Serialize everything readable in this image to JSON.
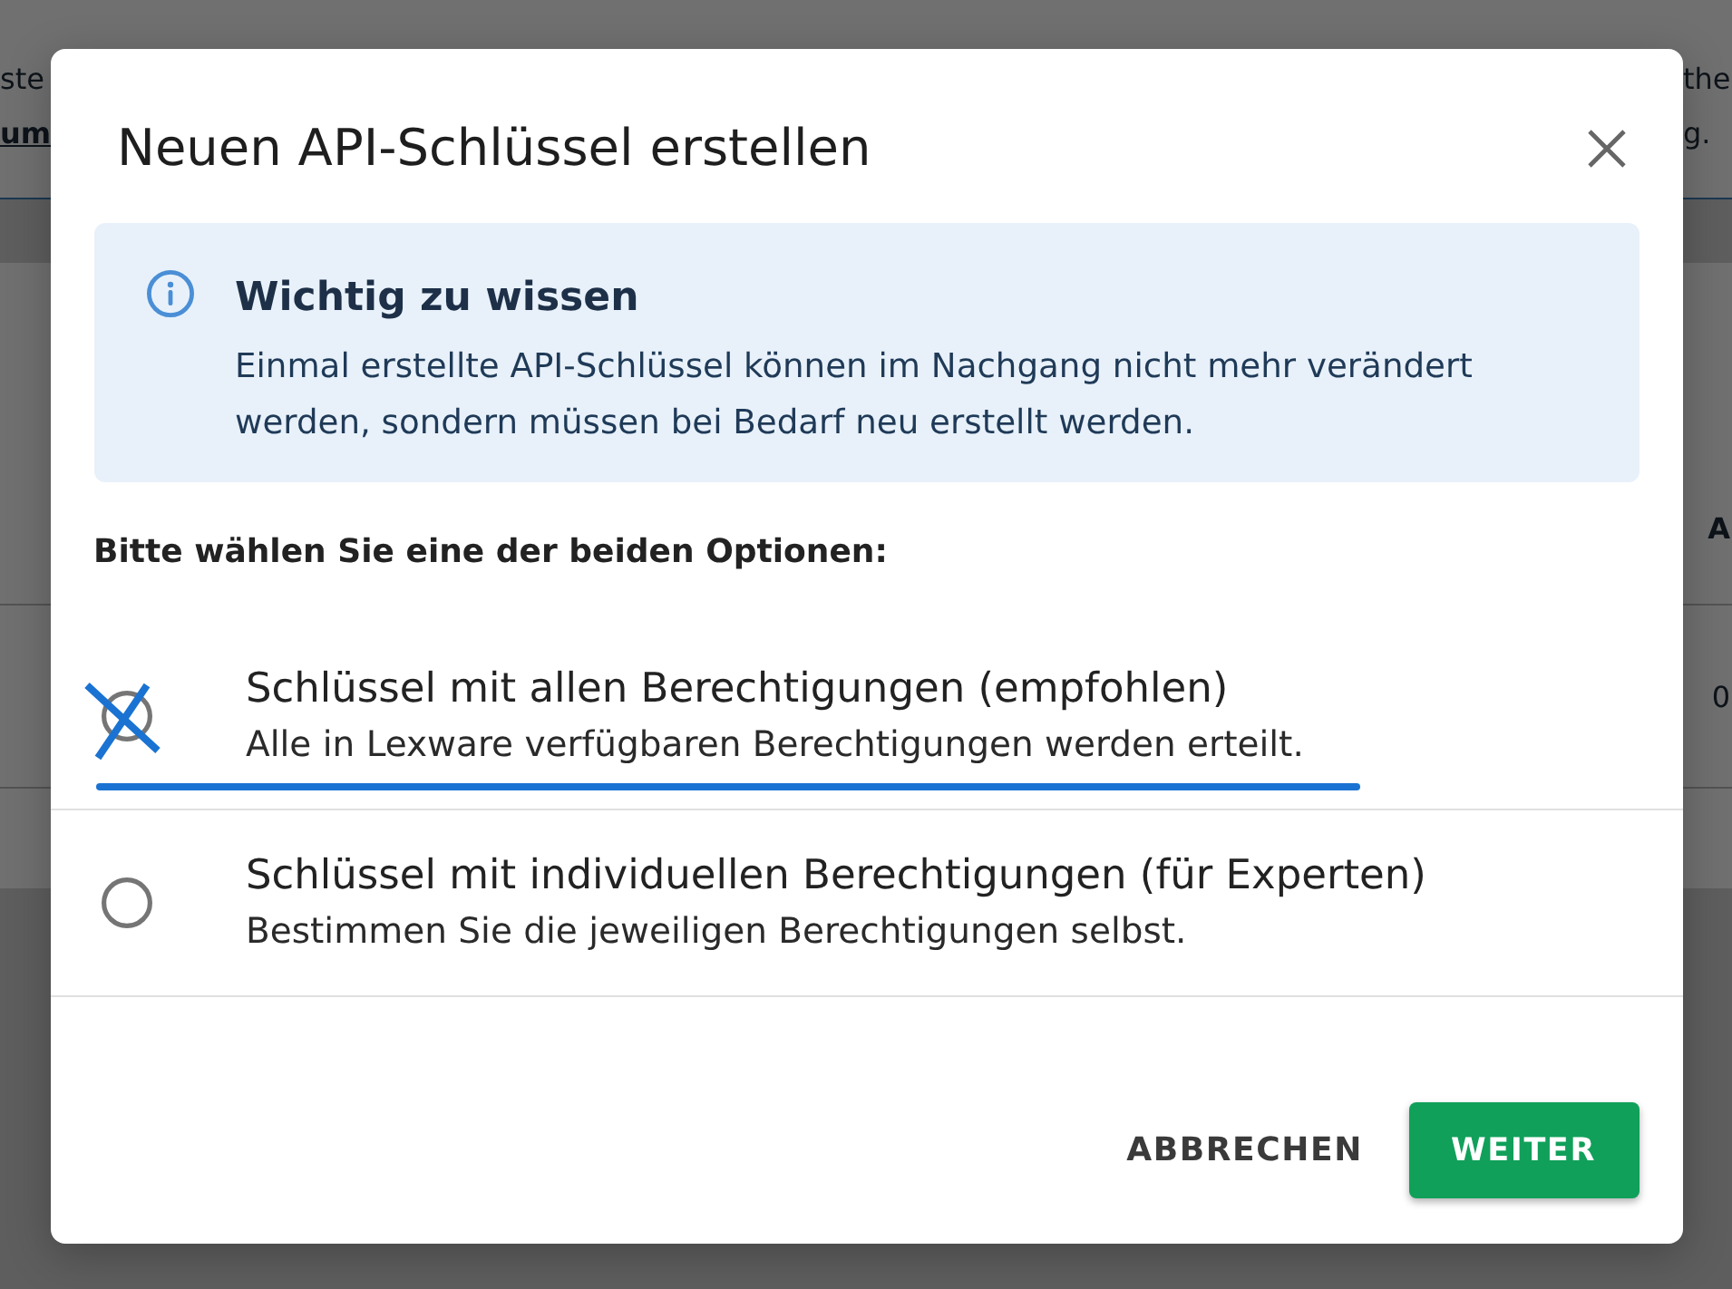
{
  "background": {
    "header_left": [
      {
        "text": "ste",
        "kind": "text"
      },
      {
        "text": "um",
        "kind": "link"
      }
    ],
    "header_right": [
      {
        "text": "the",
        "kind": "text"
      },
      {
        "text": "g.",
        "kind": "text"
      }
    ],
    "table": {
      "column_1": "A",
      "rows": [
        "0"
      ]
    }
  },
  "dialog": {
    "title": "Neuen API-Schlüssel erstellen",
    "info": {
      "title": "Wichtig zu wissen",
      "text": "Einmal erstellte API-Schlüssel können im Nachgang nicht mehr verändert werden, sondern müssen bei Bedarf neu erstellt werden."
    },
    "prompt": "Bitte wählen Sie eine der beiden Optionen:",
    "options": [
      {
        "title": "Schlüssel mit allen Berechtigungen (empfohlen)",
        "description": "Alle in Lexware verfügbaren Berechtigungen werden erteilt.",
        "selected": false,
        "crossed_out": true,
        "underlined": true
      },
      {
        "title": "Schlüssel mit individuellen Berechtigungen (für Experten)",
        "description": "Bestimmen Sie die jeweiligen Berechtigungen selbst.",
        "selected": false,
        "crossed_out": false,
        "underlined": false
      }
    ],
    "buttons": [
      {
        "label": "ABBRECHEN",
        "kind": "text"
      },
      {
        "label": "WEITER",
        "kind": "primary"
      }
    ]
  }
}
